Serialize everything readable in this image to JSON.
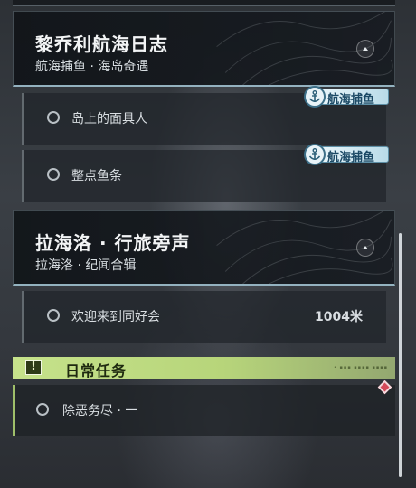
{
  "groups": [
    {
      "title": "黎乔利航海日志",
      "subtitle": "航海捕鱼 · 海岛奇遇",
      "tasks": [
        {
          "label": "岛上的面具人",
          "badge": "航海捕鱼"
        },
        {
          "label": "整点鱼条",
          "badge": "航海捕鱼"
        }
      ]
    },
    {
      "title": "拉海洛 · 行旅旁声",
      "subtitle": "拉海洛 · 纪闻合辑",
      "tasks": [
        {
          "label": "欢迎来到同好会",
          "distance": "1004米"
        }
      ]
    }
  ],
  "daily": {
    "title": "日常任务",
    "icon_glyph": "!",
    "tasks": [
      {
        "label": "除恶务尽 · 一"
      }
    ]
  },
  "colors": {
    "accent_green": "#c6e28b",
    "badge_blue": "#1c4a66",
    "marker_red": "#d64a5a"
  },
  "icons": {
    "collapse": "chevron-up-icon",
    "badge": "anchor-icon",
    "task_status": "circle-outline-icon",
    "daily": "exclamation-icon",
    "marker": "diamond-marker-icon"
  }
}
